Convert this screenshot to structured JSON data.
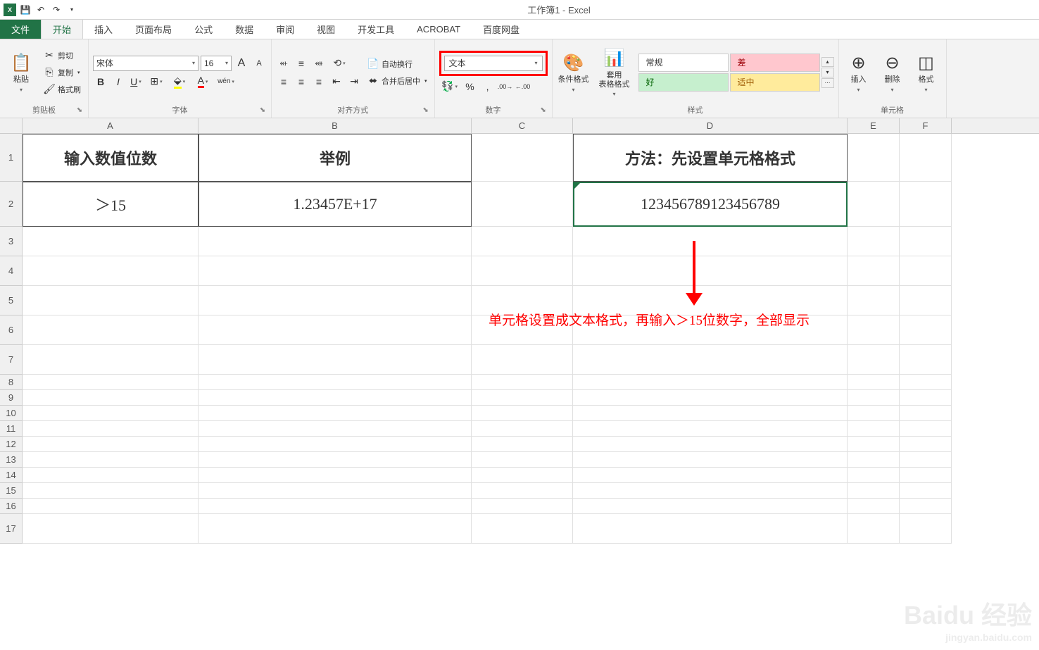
{
  "title": "工作簿1 - Excel",
  "tabs": {
    "file": "文件",
    "home": "开始",
    "insert": "插入",
    "layout": "页面布局",
    "formulas": "公式",
    "data": "数据",
    "review": "审阅",
    "view": "视图",
    "developer": "开发工具",
    "acrobat": "ACROBAT",
    "baidu": "百度网盘"
  },
  "ribbon": {
    "clipboard": {
      "label": "剪贴板",
      "paste": "粘贴",
      "cut": "剪切",
      "copy": "复制",
      "format_painter": "格式刷"
    },
    "font": {
      "label": "字体",
      "name": "宋体",
      "size": "16"
    },
    "alignment": {
      "label": "对齐方式",
      "wrap": "自动换行",
      "merge": "合并后居中"
    },
    "number": {
      "label": "数字",
      "format": "文本"
    },
    "styles": {
      "label": "样式",
      "conditional": "条件格式",
      "table": "套用\n表格格式",
      "normal": "常规",
      "bad": "差",
      "good": "好",
      "neutral": "适中"
    },
    "cells": {
      "label": "单元格",
      "insert": "插入",
      "delete": "删除",
      "format": "格式"
    }
  },
  "columns": [
    "A",
    "B",
    "C",
    "D",
    "E",
    "F"
  ],
  "rows": [
    "1",
    "2",
    "3",
    "4",
    "5",
    "6",
    "7",
    "8",
    "9",
    "10",
    "11",
    "12",
    "13",
    "14",
    "15",
    "16",
    "17"
  ],
  "grid": {
    "A1": "输入数值位数",
    "B1": "举例",
    "D1": "方法：先设置单元格格式",
    "A2": "＞15",
    "B2": "1.23457E+17",
    "D2": "123456789123456789"
  },
  "annotation": "单元格设置成文本格式，再输入＞15位数字，全部显示",
  "watermark": {
    "main": "Baidu 经验",
    "sub": "jingyan.baidu.com"
  }
}
